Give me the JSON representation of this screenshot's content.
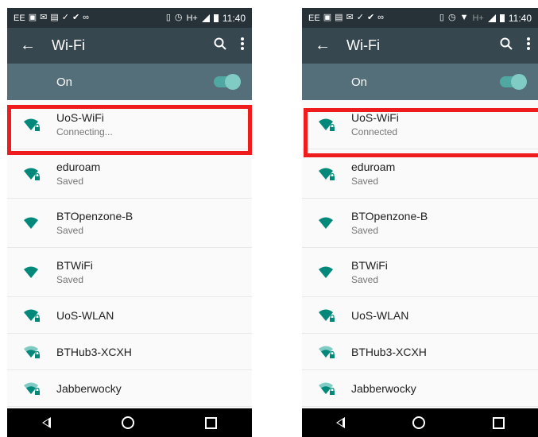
{
  "colors": {
    "statusbar": "#263238",
    "toolbar": "#37474f",
    "switchbar": "#546e7a",
    "accent": "#00897b",
    "highlight": "#ee1c1c"
  },
  "left": {
    "status": {
      "carrier": "EE",
      "network": "H+",
      "time": "11:40"
    },
    "toolbar": {
      "title": "Wi-Fi"
    },
    "switch": {
      "label": "On",
      "state": "on"
    },
    "networks": [
      {
        "ssid": "UoS-WiFi",
        "status": "Connecting...",
        "signal": "full",
        "locked": true
      },
      {
        "ssid": "eduroam",
        "status": "Saved",
        "signal": "full",
        "locked": true
      },
      {
        "ssid": "BTOpenzone-B",
        "status": "Saved",
        "signal": "full",
        "locked": false
      },
      {
        "ssid": "BTWiFi",
        "status": "Saved",
        "signal": "full",
        "locked": false
      },
      {
        "ssid": "UoS-WLAN",
        "status": "",
        "signal": "full",
        "locked": true
      },
      {
        "ssid": "BTHub3-XCXH",
        "status": "",
        "signal": "medium",
        "locked": true
      },
      {
        "ssid": "Jabberwocky",
        "status": "",
        "signal": "medium",
        "locked": true
      }
    ]
  },
  "right": {
    "status": {
      "carrier": "EE",
      "network": "H+",
      "time": "11:40"
    },
    "toolbar": {
      "title": "Wi-Fi"
    },
    "switch": {
      "label": "On",
      "state": "on"
    },
    "networks": [
      {
        "ssid": "UoS-WiFi",
        "status": "Connected",
        "signal": "full",
        "locked": true
      },
      {
        "ssid": "eduroam",
        "status": "Saved",
        "signal": "full",
        "locked": true
      },
      {
        "ssid": "BTOpenzone-B",
        "status": "Saved",
        "signal": "full",
        "locked": false
      },
      {
        "ssid": "BTWiFi",
        "status": "Saved",
        "signal": "full",
        "locked": false
      },
      {
        "ssid": "UoS-WLAN",
        "status": "",
        "signal": "full",
        "locked": true
      },
      {
        "ssid": "BTHub3-XCXH",
        "status": "",
        "signal": "medium",
        "locked": true
      },
      {
        "ssid": "Jabberwocky",
        "status": "",
        "signal": "medium",
        "locked": true
      }
    ]
  }
}
